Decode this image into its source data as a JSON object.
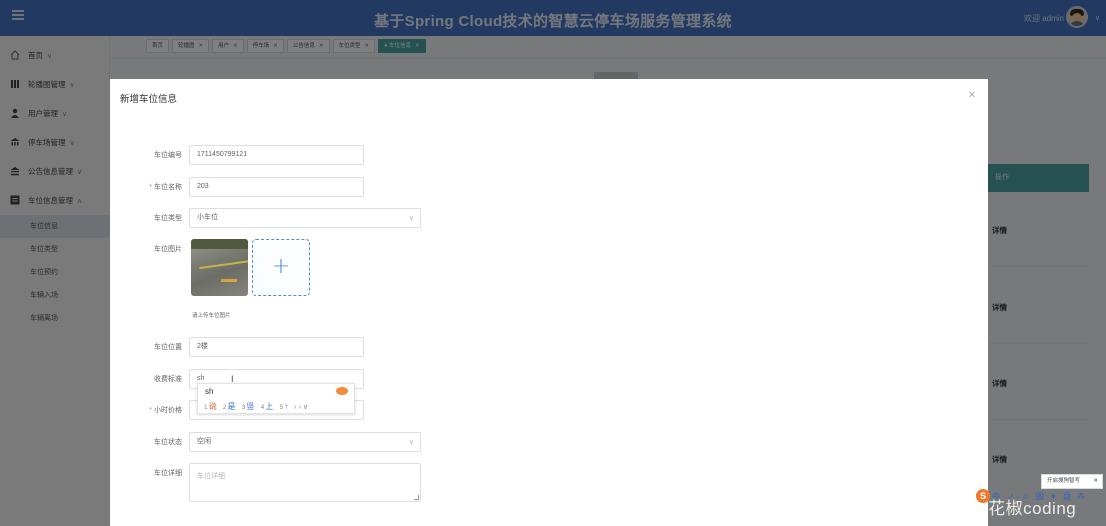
{
  "header": {
    "title": "基于Spring Cloud技术的智慧云停车场服务管理系统",
    "welcome": "欢迎 admin"
  },
  "sidebar": {
    "items": [
      {
        "label": "首页",
        "icon": "home-icon"
      },
      {
        "label": "轮播图管理",
        "icon": "bars-icon"
      },
      {
        "label": "用户管理",
        "icon": "user-icon"
      },
      {
        "label": "停车场管理",
        "icon": "building-icon"
      },
      {
        "label": "公告信息管理",
        "icon": "bank-icon"
      },
      {
        "label": "车位信息管理",
        "icon": "menu-icon"
      }
    ],
    "sub_items": [
      "车位信息",
      "车位类型",
      "车位预约",
      "车辆入场",
      "车辆离场"
    ]
  },
  "tabs": [
    "首页",
    "轮播图",
    "用户",
    "停车场",
    "公告信息",
    "车位类型",
    "车位信息"
  ],
  "background": {
    "col_header": "操作",
    "detail_label": "详情"
  },
  "dialog": {
    "title": "新增车位信息",
    "fields": {
      "code_label": "车位编号",
      "code_value": "1711450799121",
      "name_label": "车位名称",
      "name_value": "203",
      "type_label": "车位类型",
      "type_value": "小车位",
      "image_label": "车位图片",
      "upload_tip": "请上传车位图片",
      "location_label": "车位位置",
      "location_value": "2楼",
      "fee_label": "收费标准",
      "fee_value": "sh",
      "hourly_label": "小时价格",
      "status_label": "车位状态",
      "status_value": "空闲",
      "detail_label": "车位详细",
      "detail_placeholder": "车位详细"
    }
  },
  "ime": {
    "composition": "sh",
    "candidates": [
      {
        "n": "1",
        "text": "说"
      },
      {
        "n": "2",
        "text": "是"
      },
      {
        "n": "3",
        "text": "竖"
      },
      {
        "n": "4",
        "text": "上"
      },
      {
        "n": "5",
        "text": "↑"
      }
    ]
  },
  "toast": {
    "text": "开启搜狗智写"
  },
  "watermark": "CSDN @花椒coding",
  "ime_bar": {
    "text": "中·ノ·☺ 图 ✦ 盘 ⁂"
  },
  "colors": {
    "header": "#4472c4",
    "accent": "#4aa3a3",
    "primary": "#4a8fd6",
    "required": "#f56c6c"
  }
}
